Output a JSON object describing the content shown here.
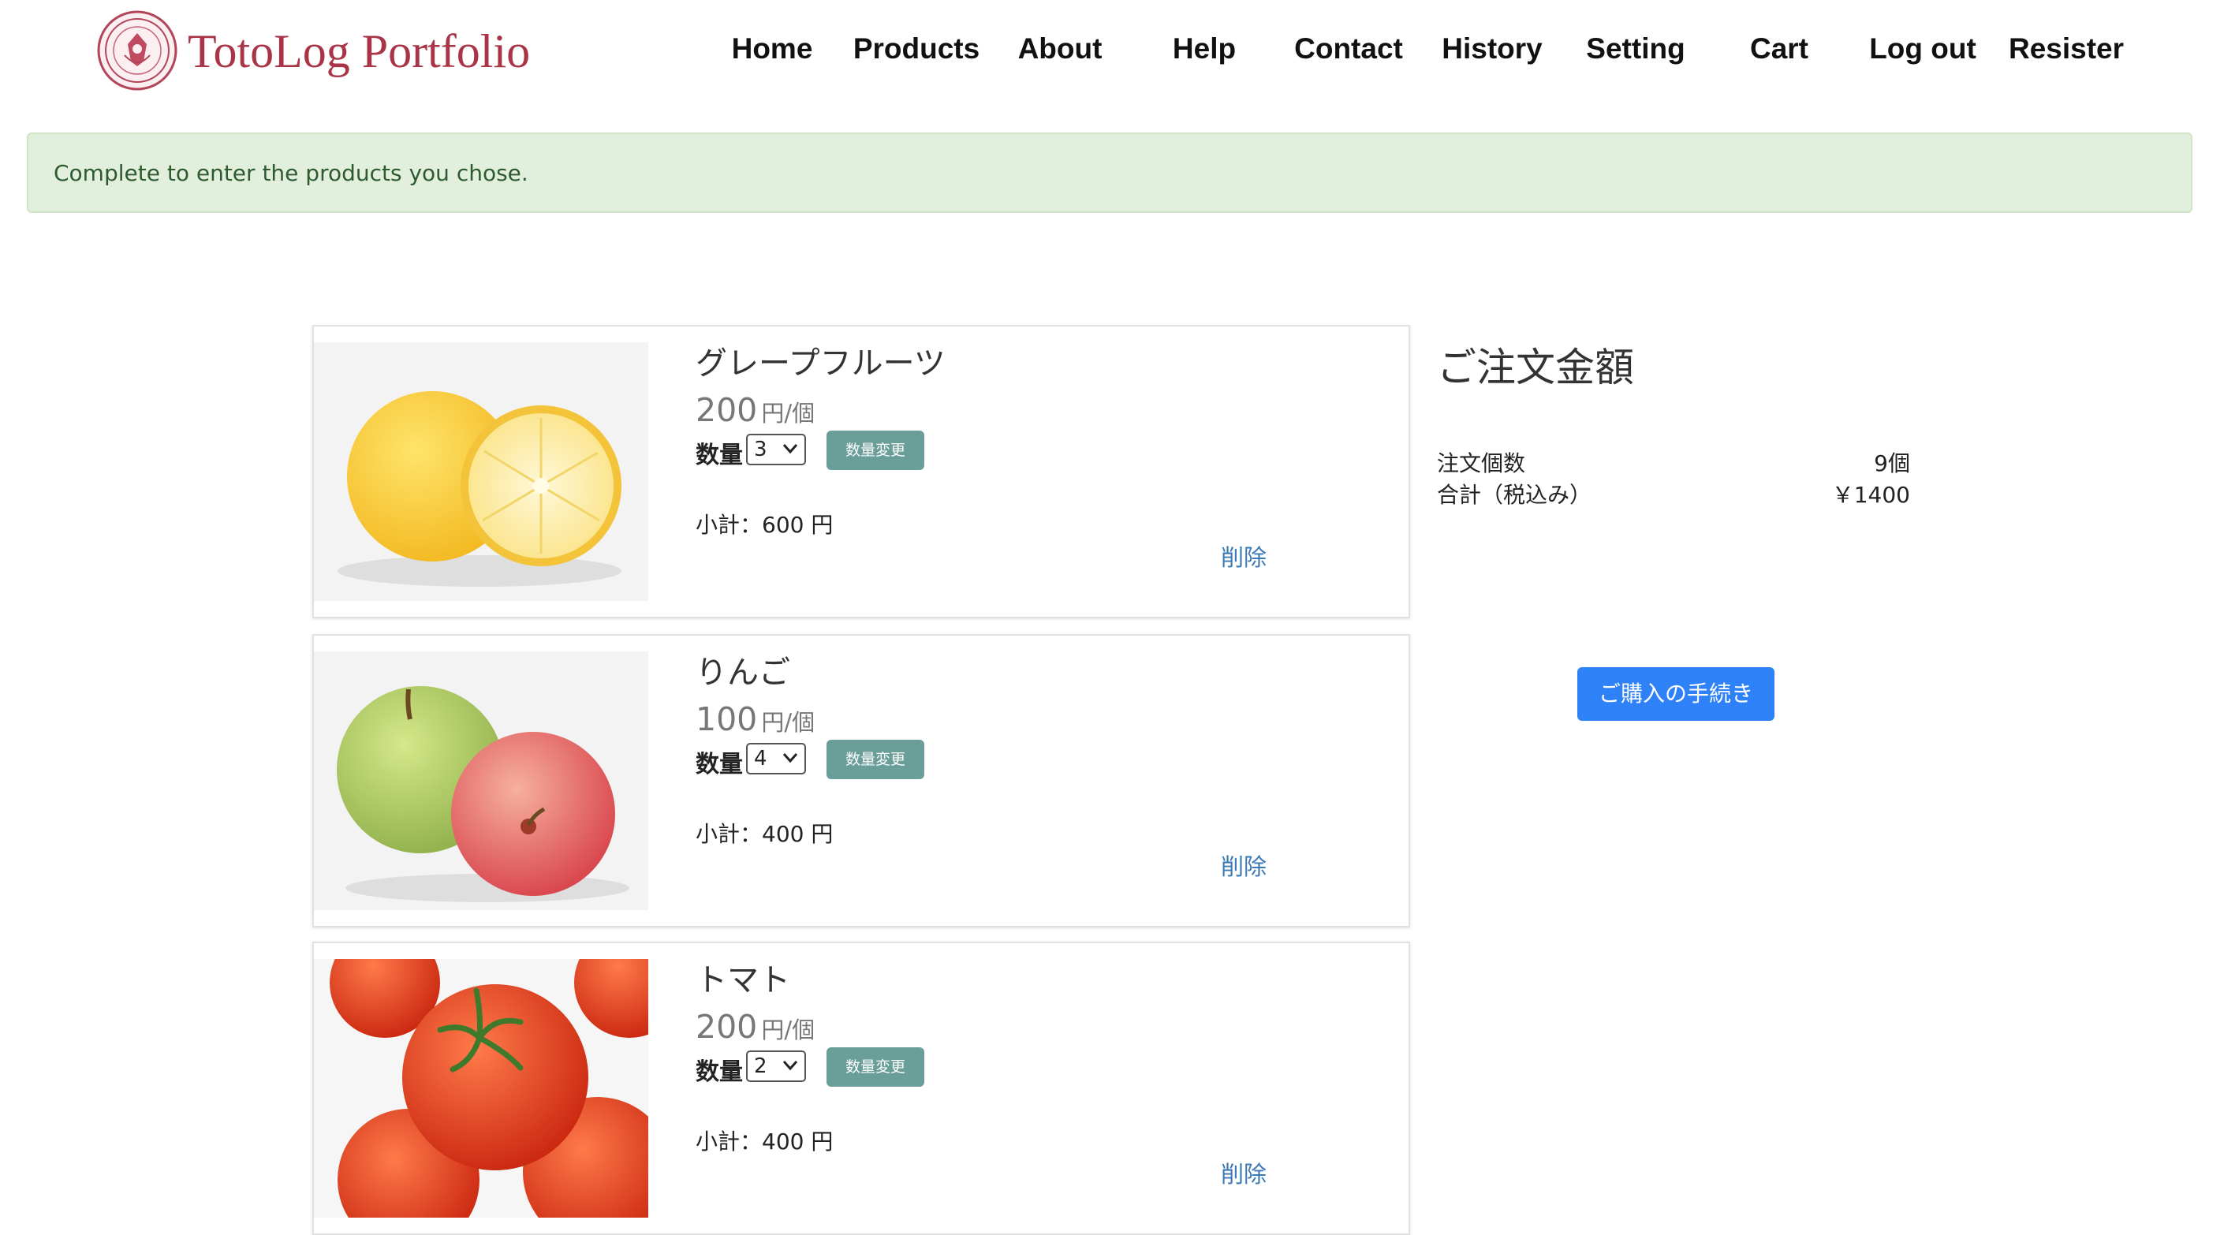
{
  "header": {
    "brand": "TotoLog Portfolio",
    "nav": [
      {
        "label": "Home"
      },
      {
        "label": "Products"
      },
      {
        "label": "About"
      },
      {
        "label": "Help"
      },
      {
        "label": "Contact"
      },
      {
        "label": "History"
      },
      {
        "label": "Setting"
      },
      {
        "label": "Cart"
      },
      {
        "label": "Log out"
      },
      {
        "label": "Resister"
      }
    ]
  },
  "alert": {
    "message": "Complete to enter the products you chose."
  },
  "cart": {
    "items": [
      {
        "name": "グレープフルーツ",
        "price": "200",
        "price_unit": "円/個",
        "qty_label": "数量",
        "qty": "3",
        "update_label": "数量変更",
        "subtotal": "小計：600 円",
        "delete_label": "削除",
        "image": "grapefruit"
      },
      {
        "name": "りんご",
        "price": "100",
        "price_unit": "円/個",
        "qty_label": "数量",
        "qty": "4",
        "update_label": "数量変更",
        "subtotal": "小計：400 円",
        "delete_label": "削除",
        "image": "apple"
      },
      {
        "name": "トマト",
        "price": "200",
        "price_unit": "円/個",
        "qty_label": "数量",
        "qty": "2",
        "update_label": "数量変更",
        "subtotal": "小計：400 円",
        "delete_label": "削除",
        "image": "tomato"
      }
    ]
  },
  "summary": {
    "title": "ご注文金額",
    "count_label": "注文個数",
    "count_value": "9個",
    "total_label": "合計（税込み）",
    "total_value": "￥1400",
    "checkout_label": "ご購入の手続き"
  },
  "colors": {
    "brand": "#a93447",
    "alert_bg": "#e2efdc",
    "qty_button": "#6a9e99",
    "checkout_button": "#2f81f7",
    "link": "#3b79b6"
  }
}
